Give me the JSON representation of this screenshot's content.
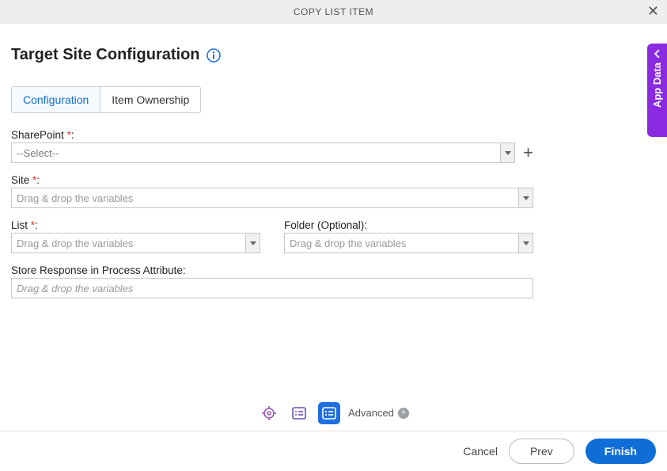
{
  "header": {
    "title": "COPY LIST ITEM"
  },
  "page": {
    "title": "Target Site Configuration"
  },
  "tabs": [
    {
      "label": "Configuration",
      "active": true
    },
    {
      "label": "Item Ownership",
      "active": false
    }
  ],
  "fields": {
    "sharepoint": {
      "label": "SharePoint",
      "required": true,
      "value": "--Select--"
    },
    "site": {
      "label": "Site",
      "required": true,
      "placeholder": "Drag & drop the variables"
    },
    "list": {
      "label": "List",
      "required": true,
      "placeholder": "Drag & drop the variables"
    },
    "folder": {
      "label": "Folder (Optional):",
      "placeholder": "Drag & drop the variables"
    },
    "store": {
      "label": "Store Response in Process Attribute:",
      "placeholder": "Drag & drop the variables"
    }
  },
  "sideTab": {
    "label": "App Data"
  },
  "toolbar": {
    "advanced": "Advanced"
  },
  "footer": {
    "cancel": "Cancel",
    "prev": "Prev",
    "finish": "Finish"
  }
}
